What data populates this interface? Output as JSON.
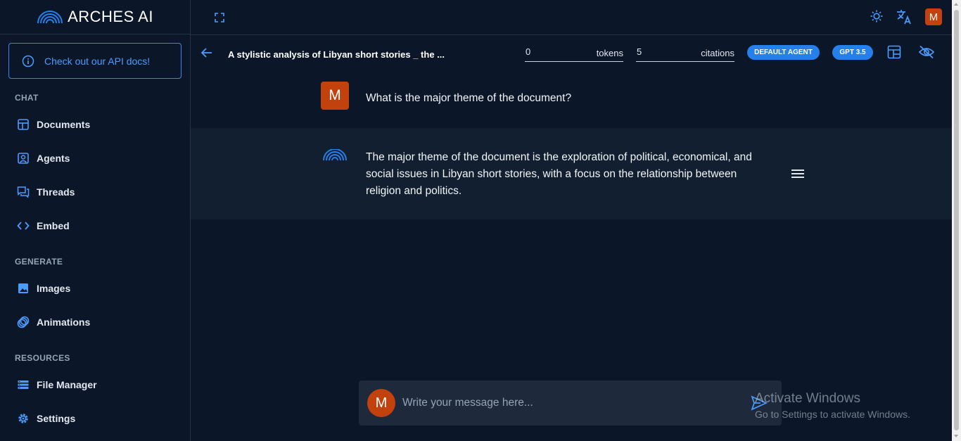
{
  "brand": {
    "name": "ARCHES AI"
  },
  "sidebar": {
    "api_notice": "Check out our API docs!",
    "sections": [
      {
        "label": "CHAT",
        "items": [
          {
            "label": "Documents",
            "icon": "documents-icon"
          },
          {
            "label": "Agents",
            "icon": "agents-icon"
          },
          {
            "label": "Threads",
            "icon": "threads-icon"
          },
          {
            "label": "Embed",
            "icon": "code-icon"
          }
        ]
      },
      {
        "label": "GENERATE",
        "items": [
          {
            "label": "Images",
            "icon": "image-icon"
          },
          {
            "label": "Animations",
            "icon": "animation-icon"
          }
        ]
      },
      {
        "label": "RESOURCES",
        "items": [
          {
            "label": "File Manager",
            "icon": "file-manager-icon"
          },
          {
            "label": "Settings",
            "icon": "gear-icon"
          }
        ]
      }
    ]
  },
  "topbar": {
    "avatar_initial": "M"
  },
  "header": {
    "title": "A stylistic analysis of Libyan short stories _ the ...",
    "tokens_value": "0",
    "tokens_label": "tokens",
    "citations_value": "5",
    "citations_label": "citations",
    "agent_badge": "DEFAULT AGENT",
    "model_badge": "GPT 3.5"
  },
  "messages": [
    {
      "role": "user",
      "avatar": "M",
      "text": "What is the major theme of the document?"
    },
    {
      "role": "assistant",
      "text_lines": [
        "The major theme of the document is the exploration of political, economical, and",
        "social issues in Libyan short stories, with a focus on the relationship between",
        "religion and politics."
      ]
    }
  ],
  "composer": {
    "avatar": "M",
    "placeholder": "Write your message here..."
  },
  "watermark": {
    "title": "Activate Windows",
    "subtitle": "Go to Settings to activate Windows."
  },
  "colors": {
    "accent": "#2680eb",
    "avatar": "#c2410c",
    "background": "#0b1729",
    "panel": "#121f30"
  }
}
